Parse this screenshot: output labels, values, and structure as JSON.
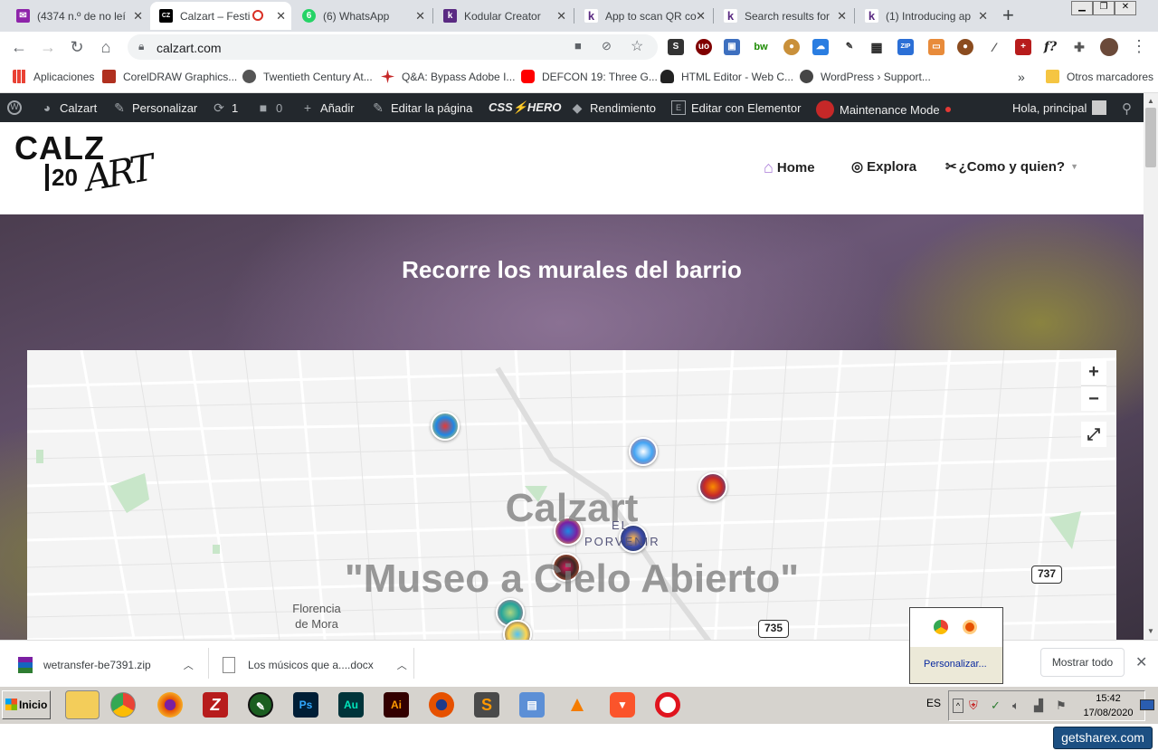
{
  "browser": {
    "tabs": [
      {
        "title": "(4374 n.º de no leí",
        "icon": "gmail-icon",
        "color": "#8e24aa",
        "active": false
      },
      {
        "title": "Calzart – Festi",
        "icon": "calzart-icon",
        "color": "#000000",
        "active": true
      },
      {
        "title": "(6) WhatsApp",
        "icon": "whatsapp-icon",
        "color": "#25d366",
        "active": false
      },
      {
        "title": "Kodular Creator",
        "icon": "kodular-icon",
        "color": "#5a2a82",
        "active": false
      },
      {
        "title": "App to scan QR co",
        "icon": "kodular-icon",
        "color": "#ffffff",
        "active": false
      },
      {
        "title": "Search results for",
        "icon": "kodular-icon",
        "color": "#ffffff",
        "active": false
      },
      {
        "title": "(1) Introducing ap",
        "icon": "kodular-icon",
        "color": "#ffffff",
        "active": false
      }
    ],
    "new_tab": "+",
    "url": "calzart.com",
    "bookmarks": [
      "Aplicaciones",
      "CorelDRAW Graphics...",
      "Twentieth Century At...",
      "Q&A: Bypass Adobe I...",
      "DEFCON 19: Three G...",
      "HTML Editor - Web C...",
      "WordPress › Support..."
    ],
    "bookmarks_more": "»",
    "other_bookmarks": "Otros marcadores"
  },
  "wp_admin_bar": {
    "site": "Calzart",
    "customize": "Personalizar",
    "updates": "1",
    "comments": "0",
    "add_new": "Añadir",
    "edit_page": "Editar la página",
    "csshero": "CSS⚡HERO",
    "performance": "Rendimiento",
    "elementor": "Editar con Elementor",
    "maintenance": "Maintenance Mode",
    "greeting": "Hola, principal"
  },
  "site": {
    "logo_line1": "CALZ",
    "logo_line2": "20",
    "logo_script": "ART",
    "nav": [
      {
        "label": "Home",
        "icon": "home-icon"
      },
      {
        "label": "Explora",
        "icon": "compass-icon"
      },
      {
        "label": "¿Como y quien?",
        "icon": "tools-icon"
      }
    ]
  },
  "hero": {
    "title": "Recorre los murales del barrio"
  },
  "map": {
    "overlay_title": "Calzart",
    "overlay_subtitle": "\"Museo a Cielo Abierto\"",
    "place_el_porvenir_1": "EL",
    "place_el_porvenir_2": "PORVENIR",
    "place_florencia_1": "Florencia",
    "place_florencia_2": "de Mora",
    "road_737": "737",
    "road_735": "735",
    "zoom_in": "+",
    "zoom_out": "−",
    "fullscreen": "⤢"
  },
  "downloads": {
    "items": [
      "wetransfer-be7391.zip",
      "Los músicos que a....docx"
    ],
    "show_all": "Mostrar todo",
    "popup_label": "Personalizar..."
  },
  "taskbar": {
    "start": "Inicio",
    "lang": "ES",
    "time": "15:42",
    "date": "17/08/2020",
    "watermark": "getsharex.com"
  }
}
